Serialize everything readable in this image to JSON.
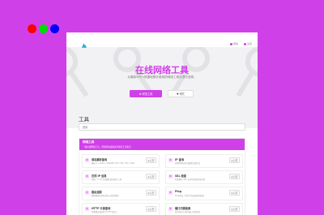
{
  "window_controls": {
    "colors": [
      "#ff0000",
      "#00dd00",
      "#0000ff"
    ]
  },
  "nav": {
    "logo_icon": "app-logo",
    "link_1": "帮助",
    "link_2": "设置"
  },
  "hero": {
    "title": "在线网络工具",
    "subtitle": "从模拟XFS→快捷地是手使用的网络工具中进行选择。",
    "primary_button": "⚙ 浏览工具",
    "secondary_button": "♥ 帮忙"
  },
  "tools": {
    "section_title": "工具",
    "search_placeholder": "搜索",
    "panel_title": "网络工具",
    "panel_desc": "一组在线网络工具，帮助您快速解决问题的工具集合",
    "items": [
      {
        "name": "域名解析查询",
        "desc": "解析 A / AAAA / CNAME / MX / NS / TXT / SOA",
        "action": "⊕ 打开"
      },
      {
        "name": "IP 查询",
        "desc": "查看IP地址的归属地位置信息",
        "action": "⊕ 打开"
      },
      {
        "name": "在线 IP 信息",
        "desc": "获取一个 IP 的详细信息和相关工具",
        "action": "⊕ 打开"
      },
      {
        "name": "SSL 检查",
        "desc": "检查网站 SSL 证书的有效性和详情",
        "action": "⊕ 打开"
      },
      {
        "name": "路由追踪",
        "desc": "跟踪数据包到达目标主机的路径",
        "action": "⊕ 打开"
      },
      {
        "name": "Ping",
        "desc": "Ping测试，检查主机连通性和延迟",
        "action": "⊕ 打开"
      },
      {
        "name": "HTTP 头部查询",
        "desc": "查看网站返回的 HTTP 响应头",
        "action": "⊕ 打开"
      },
      {
        "name": "端口扫描检测",
        "desc": "检测目标主机的端口开放情况",
        "action": "⊕ 打开"
      }
    ]
  },
  "colors": {
    "accent": "#d040e8",
    "background": "#d040e8",
    "hero_bg": "#f2f2f4"
  }
}
